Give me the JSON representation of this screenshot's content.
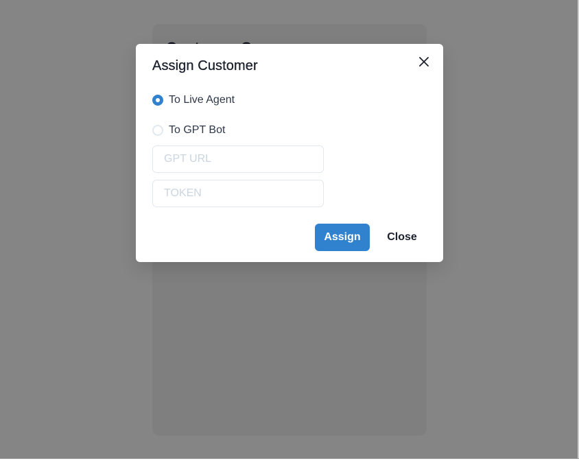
{
  "background": {
    "card_title": "Customer Q"
  },
  "modal": {
    "title": "Assign Customer",
    "close_icon": "close-icon",
    "options": [
      {
        "label": "To Live Agent",
        "checked": true
      },
      {
        "label": "To GPT Bot",
        "checked": false
      }
    ],
    "gpt_url": {
      "value": "",
      "placeholder": "GPT URL"
    },
    "token": {
      "value": "",
      "placeholder": "TOKEN"
    },
    "assign_label": "Assign",
    "close_label": "Close"
  },
  "colors": {
    "primary": "#3182ce",
    "overlay": "rgba(0,0,0,0.48)",
    "text": "#1a202c",
    "border": "#e2e8f0"
  }
}
